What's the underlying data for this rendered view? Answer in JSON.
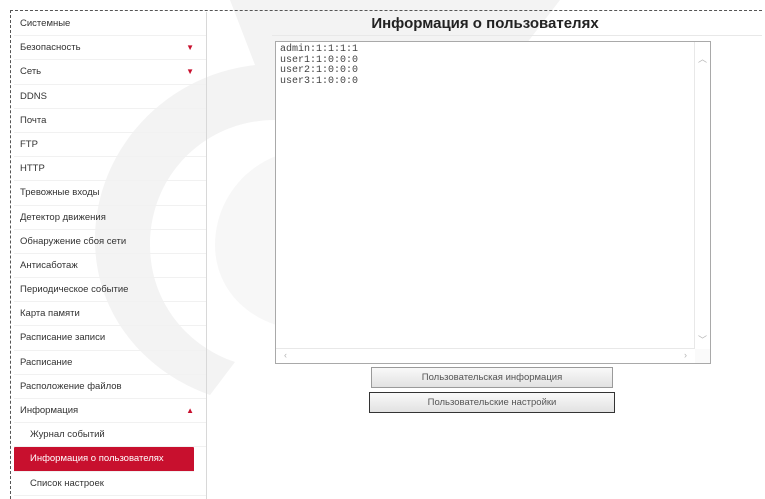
{
  "sidebar": {
    "items": [
      {
        "label": "Системные",
        "arrow": "",
        "sub": false,
        "active": false
      },
      {
        "label": "Безопасность",
        "arrow": "▼",
        "sub": false,
        "active": false
      },
      {
        "label": "Сеть",
        "arrow": "▼",
        "sub": false,
        "active": false
      },
      {
        "label": "DDNS",
        "arrow": "",
        "sub": false,
        "active": false
      },
      {
        "label": "Почта",
        "arrow": "",
        "sub": false,
        "active": false
      },
      {
        "label": "FTP",
        "arrow": "",
        "sub": false,
        "active": false
      },
      {
        "label": "HTTP",
        "arrow": "",
        "sub": false,
        "active": false
      },
      {
        "label": "Тревожные входы",
        "arrow": "",
        "sub": false,
        "active": false
      },
      {
        "label": "Детектор движения",
        "arrow": "",
        "sub": false,
        "active": false
      },
      {
        "label": "Обнаружение сбоя сети",
        "arrow": "",
        "sub": false,
        "active": false
      },
      {
        "label": "Антисаботаж",
        "arrow": "",
        "sub": false,
        "active": false
      },
      {
        "label": "Периодическое событие",
        "arrow": "",
        "sub": false,
        "active": false
      },
      {
        "label": "Карта памяти",
        "arrow": "",
        "sub": false,
        "active": false
      },
      {
        "label": "Расписание записи",
        "arrow": "",
        "sub": false,
        "active": false
      },
      {
        "label": "Расписание",
        "arrow": "",
        "sub": false,
        "active": false
      },
      {
        "label": "Расположение файлов",
        "arrow": "",
        "sub": false,
        "active": false
      },
      {
        "label": "Информация",
        "arrow": "▲",
        "sub": false,
        "active": false
      },
      {
        "label": "Журнал событий",
        "arrow": "",
        "sub": true,
        "active": false
      },
      {
        "label": "Информация о пользователях",
        "arrow": "",
        "sub": true,
        "active": true
      },
      {
        "label": "Список настроек",
        "arrow": "",
        "sub": true,
        "active": false
      }
    ]
  },
  "main": {
    "title": "Информация о пользователях",
    "user_info_lines": [
      "admin:1:1:1:1",
      "user1:1:0:0:0",
      "user2:1:0:0:0",
      "user3:1:0:0:0"
    ],
    "btn_user_info": "Пользовательская информация",
    "btn_user_settings": "Пользовательские настройки"
  },
  "colors": {
    "accent": "#c8102e",
    "watermark": "#f2f2f2"
  }
}
